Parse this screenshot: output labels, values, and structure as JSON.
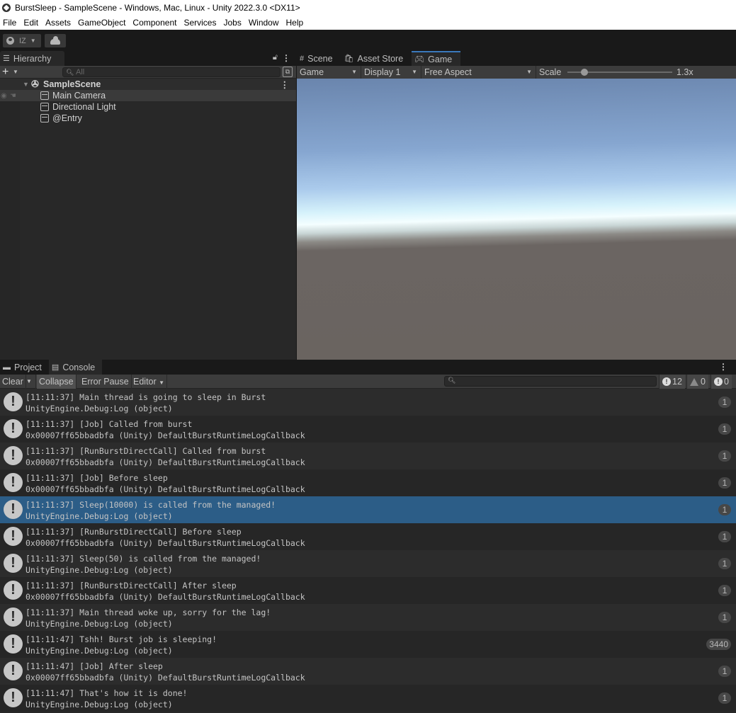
{
  "window": {
    "title": "BurstSleep - SampleScene - Windows, Mac, Linux - Unity 2022.3.0 <DX11>"
  },
  "menubar": {
    "items": [
      "File",
      "Edit",
      "Assets",
      "GameObject",
      "Component",
      "Services",
      "Jobs",
      "Window",
      "Help"
    ]
  },
  "toolbar": {
    "account_label": "IZ"
  },
  "hierarchy": {
    "tab_label": "Hierarchy",
    "search_placeholder": "All",
    "scene_name": "SampleScene",
    "objects": [
      "Main Camera",
      "Directional Light",
      "@Entry"
    ]
  },
  "gameview": {
    "tabs": [
      "Scene",
      "Asset Store",
      "Game"
    ],
    "active_tab": "Game",
    "view_mode": "Game",
    "display": "Display 1",
    "aspect": "Free Aspect",
    "scale_label": "Scale",
    "scale_value": "1.3x"
  },
  "console": {
    "tabs": [
      "Project",
      "Console"
    ],
    "active_tab": "Console",
    "toolbar": {
      "clear": "Clear",
      "collapse": "Collapse",
      "error_pause": "Error Pause",
      "editor": "Editor"
    },
    "counts": {
      "info": "12",
      "warnings": "0",
      "errors": "0"
    },
    "logs": [
      {
        "line1": "[11:11:37] Main thread is going to sleep in Burst",
        "line2": "UnityEngine.Debug:Log (object)",
        "count": "1"
      },
      {
        "line1": "[11:11:37] [Job] Called from burst",
        "line2": "0x00007ff65bbadbfa (Unity) DefaultBurstRuntimeLogCallback",
        "count": "1"
      },
      {
        "line1": "[11:11:37] [RunBurstDirectCall] Called from burst",
        "line2": "0x00007ff65bbadbfa (Unity) DefaultBurstRuntimeLogCallback",
        "count": "1"
      },
      {
        "line1": "[11:11:37] [Job] Before sleep",
        "line2": "0x00007ff65bbadbfa (Unity) DefaultBurstRuntimeLogCallback",
        "count": "1"
      },
      {
        "line1": "[11:11:37] Sleep(10000) is called from the managed!",
        "line2": "UnityEngine.Debug:Log (object)",
        "count": "1",
        "selected": true
      },
      {
        "line1": "[11:11:37] [RunBurstDirectCall] Before sleep",
        "line2": "0x00007ff65bbadbfa (Unity) DefaultBurstRuntimeLogCallback",
        "count": "1"
      },
      {
        "line1": "[11:11:37] Sleep(50) is called from the managed!",
        "line2": "UnityEngine.Debug:Log (object)",
        "count": "1"
      },
      {
        "line1": "[11:11:37] [RunBurstDirectCall] After sleep",
        "line2": "0x00007ff65bbadbfa (Unity) DefaultBurstRuntimeLogCallback",
        "count": "1"
      },
      {
        "line1": "[11:11:37] Main thread woke up, sorry for the lag!",
        "line2": "UnityEngine.Debug:Log (object)",
        "count": "1"
      },
      {
        "line1": "[11:11:47] Tshh! Burst job is sleeping!",
        "line2": "UnityEngine.Debug:Log (object)",
        "count": "3440"
      },
      {
        "line1": "[11:11:47] [Job] After sleep",
        "line2": "0x00007ff65bbadbfa (Unity) DefaultBurstRuntimeLogCallback",
        "count": "1"
      },
      {
        "line1": "[11:11:47] That's how it is done!",
        "line2": "UnityEngine.Debug:Log (object)",
        "count": "1"
      }
    ]
  },
  "colors": {
    "selection": "#2c5d87",
    "active_tab_accent": "#3a79bb",
    "panel_bg": "#282828"
  }
}
